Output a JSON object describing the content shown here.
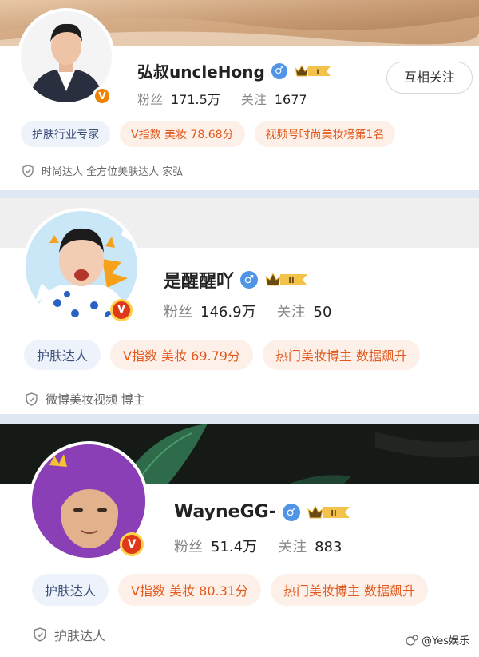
{
  "profiles": [
    {
      "name": "弘叔uncleHong",
      "verified_badge": "V",
      "level_badge": "I",
      "stats": {
        "fans_label": "粉丝",
        "fans_value": "171.5万",
        "follow_label": "关注",
        "follow_value": "1677"
      },
      "follow_button": "互相关注",
      "tags": [
        {
          "text": "护肤行业专家",
          "style": "blue"
        },
        {
          "text": "V指数 美妆 78.68分",
          "style": "orange"
        },
        {
          "text": "视频号时尚美妆榜第1名",
          "style": "orange"
        }
      ],
      "info": "时尚达人 全方位美肤达人 家弘"
    },
    {
      "name": "是醒醒吖",
      "verified_badge": "V",
      "level_badge": "II",
      "stats": {
        "fans_label": "粉丝",
        "fans_value": "146.9万",
        "follow_label": "关注",
        "follow_value": "50"
      },
      "tags": [
        {
          "text": "护肤达人",
          "style": "blue"
        },
        {
          "text": "V指数 美妆 69.79分",
          "style": "orange"
        },
        {
          "text": "热门美妆博主 数据飙升",
          "style": "orange"
        }
      ],
      "info": "微博美妆视频 博主"
    },
    {
      "name": "WayneGG-",
      "verified_badge": "V",
      "level_badge": "II",
      "stats": {
        "fans_label": "粉丝",
        "fans_value": "51.4万",
        "follow_label": "关注",
        "follow_value": "883"
      },
      "tags": [
        {
          "text": "护肤达人",
          "style": "blue"
        },
        {
          "text": "V指数 美妆 80.31分",
          "style": "orange"
        },
        {
          "text": "热门美妆博主 数据飙升",
          "style": "orange"
        }
      ],
      "info": "护肤达人"
    }
  ],
  "gender_symbol": "♂",
  "watermark": "@Yes娱乐",
  "colors": {
    "accent_orange": "#e2581c",
    "tag_blue_bg": "#eef2fa",
    "tag_orange_bg": "#fdf0e8",
    "gender_blue": "#4f94e6",
    "divider": "#dfe7f3"
  }
}
